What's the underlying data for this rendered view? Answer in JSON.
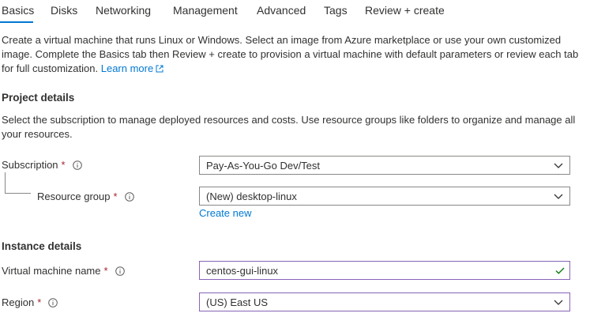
{
  "tabs": [
    {
      "label": "Basics"
    },
    {
      "label": "Disks"
    },
    {
      "label": "Networking"
    },
    {
      "label": "Management"
    },
    {
      "label": "Advanced"
    },
    {
      "label": "Tags"
    },
    {
      "label": "Review + create"
    }
  ],
  "intro": {
    "text": "Create a virtual machine that runs Linux or Windows. Select an image from Azure marketplace or use your own customized image. Complete the Basics tab then Review + create to provision a virtual machine with default parameters or review each tab for full customization.",
    "learn_more": "Learn more"
  },
  "project": {
    "title": "Project details",
    "description": "Select the subscription to manage deployed resources and costs. Use resource groups like folders to organize and manage all your resources.",
    "subscription_label": "Subscription",
    "subscription_value": "Pay-As-You-Go Dev/Test",
    "resource_group_label": "Resource group",
    "resource_group_value": "(New) desktop-linux",
    "create_new": "Create new"
  },
  "instance": {
    "title": "Instance details",
    "vm_name_label": "Virtual machine name",
    "vm_name_value": "centos-gui-linux",
    "region_label": "Region",
    "region_value": "(US) East US"
  },
  "required_mark": "*",
  "colors": {
    "accent": "#0078d4",
    "required": "#a4262c",
    "valid_border": "#8764b8",
    "valid_check": "#107c10"
  }
}
